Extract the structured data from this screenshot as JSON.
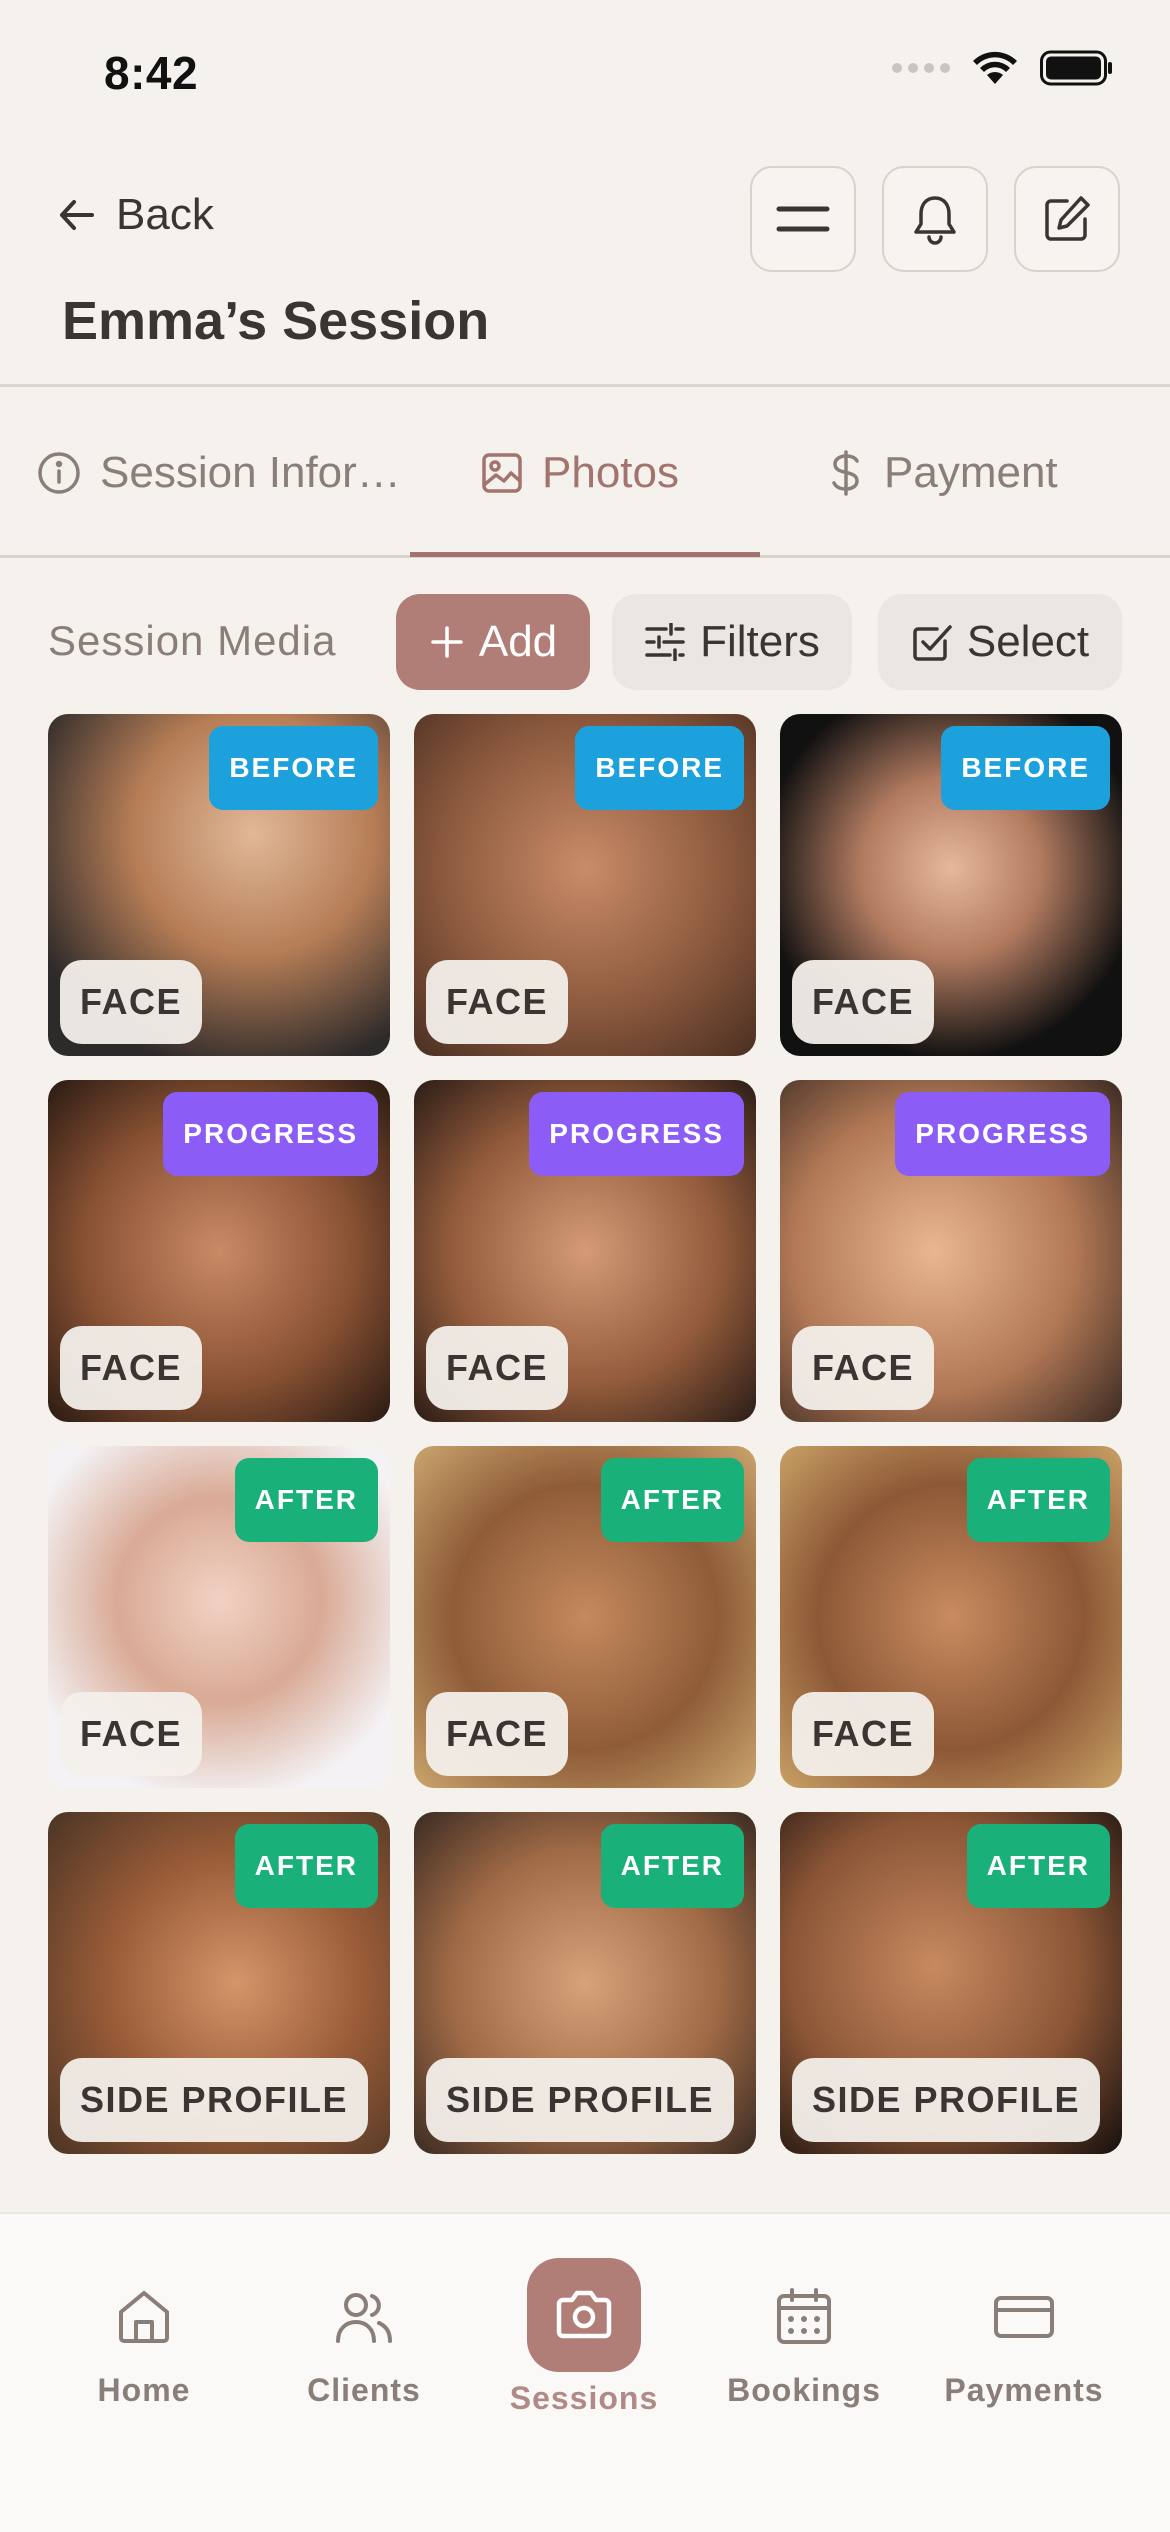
{
  "status": {
    "time": "8:42"
  },
  "header": {
    "back_label": "Back",
    "title": "Emma’s Session"
  },
  "tabs": [
    {
      "label": "Session Infor…",
      "icon": "info-icon",
      "active": false
    },
    {
      "label": "Photos",
      "icon": "image-icon",
      "active": true
    },
    {
      "label": "Payment",
      "icon": "dollar-icon",
      "active": false
    }
  ],
  "toolbar": {
    "label": "Session Media",
    "add_label": "Add",
    "filters_label": "Filters",
    "select_label": "Select"
  },
  "photos": [
    {
      "stage": "BEFORE",
      "region": "FACE"
    },
    {
      "stage": "BEFORE",
      "region": "FACE"
    },
    {
      "stage": "BEFORE",
      "region": "FACE"
    },
    {
      "stage": "PROGRESS",
      "region": "FACE"
    },
    {
      "stage": "PROGRESS",
      "region": "FACE"
    },
    {
      "stage": "PROGRESS",
      "region": "FACE"
    },
    {
      "stage": "AFTER",
      "region": "FACE"
    },
    {
      "stage": "AFTER",
      "region": "FACE"
    },
    {
      "stage": "AFTER",
      "region": "FACE"
    },
    {
      "stage": "AFTER",
      "region": "SIDE PROFILE"
    },
    {
      "stage": "AFTER",
      "region": "SIDE PROFILE"
    },
    {
      "stage": "AFTER",
      "region": "SIDE PROFILE"
    }
  ],
  "nav": [
    {
      "label": "Home",
      "icon": "home-icon"
    },
    {
      "label": "Clients",
      "icon": "users-icon"
    },
    {
      "label": "Sessions",
      "icon": "camera-icon",
      "active": true
    },
    {
      "label": "Bookings",
      "icon": "calendar-icon"
    },
    {
      "label": "Payments",
      "icon": "card-icon"
    }
  ],
  "colors": {
    "accent": "#b07d77",
    "before": "#1da1dd",
    "progress": "#8b5cf6",
    "after": "#19b07a",
    "background": "#f5f2ee"
  }
}
